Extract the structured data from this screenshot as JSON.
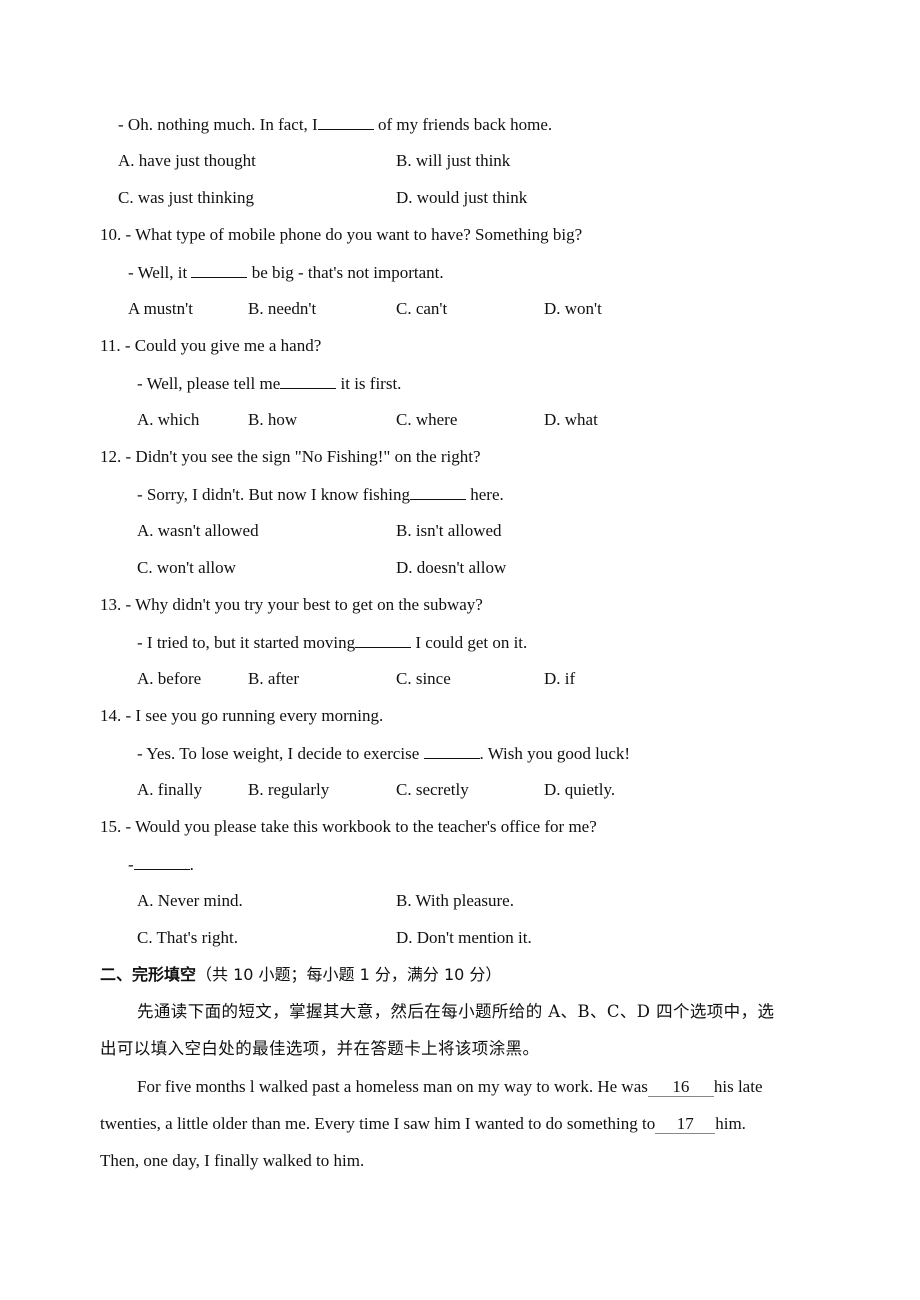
{
  "q9": {
    "answer_pre": "- Oh. nothing much. In fact, I",
    "answer_post": " of my friends back home.",
    "options": [
      "A. have just thought",
      "B. will just think",
      "C. was just thinking",
      "D. would just think"
    ]
  },
  "q10": {
    "question": "10. - What type of mobile phone do you want to have? Something big?",
    "answer_pre": "- Well, it ",
    "answer_post": " be big - that's not important.",
    "options": [
      "A mustn't",
      "B. needn't",
      "C. can't",
      "D. won't"
    ]
  },
  "q11": {
    "question": "11. - Could you give me a hand?",
    "answer_pre": "- Well, please tell me",
    "answer_post": " it is first.",
    "options": [
      "A. which",
      "B. how",
      "C. where",
      "D. what"
    ]
  },
  "q12": {
    "question": "12. - Didn't you see the sign \"No Fishing!\" on the right?",
    "answer_pre": "- Sorry, I didn't. But now I know fishing",
    "answer_post": " here.",
    "options": [
      "A. wasn't allowed",
      "B. isn't allowed",
      "C. won't allow",
      "D. doesn't allow"
    ]
  },
  "q13": {
    "question": "13. - Why didn't you try your best to get on the subway?",
    "answer_pre": "- I tried to, but it started moving",
    "answer_post": " I could get on it.",
    "options": [
      "A. before",
      "B. after",
      "C. since",
      "D. if"
    ]
  },
  "q14": {
    "question": "14. - I see you go running every morning.",
    "answer_pre": "- Yes. To lose weight, I decide to exercise ",
    "answer_post": ". Wish you good luck!",
    "options": [
      "A. finally",
      "B. regularly",
      "C. secretly",
      "D. quietly."
    ]
  },
  "q15": {
    "question": "15. - Would you please take this workbook to the teacher's office for me?",
    "answer_pre": "-",
    "answer_post": ".",
    "options": [
      "A. Never mind.",
      "B. With pleasure.",
      "C. That's right.",
      "D. Don't mention it."
    ]
  },
  "section2": {
    "title": "二、完形填空",
    "subtitle": "（共 10 小题；每小题 1 分，满分 10 分）",
    "instruction_line1": "先通读下面的短文，掌握其大意，然后在每小题所给的 A、B、C、D 四个选项中，选",
    "instruction_line2": "出可以填入空白处的最佳选项，并在答题卡上将该项涂黑。",
    "passage": {
      "line1_pre": "For five months l walked past a homeless man on my way to work. He was",
      "blank16": "16",
      "line1_post": "his late",
      "line2_pre": "twenties, a little older than me. Every time I saw him I wanted to do something to",
      "blank17": "17",
      "line2_post": "him.",
      "line3": "Then, one day, I finally walked to him."
    }
  }
}
